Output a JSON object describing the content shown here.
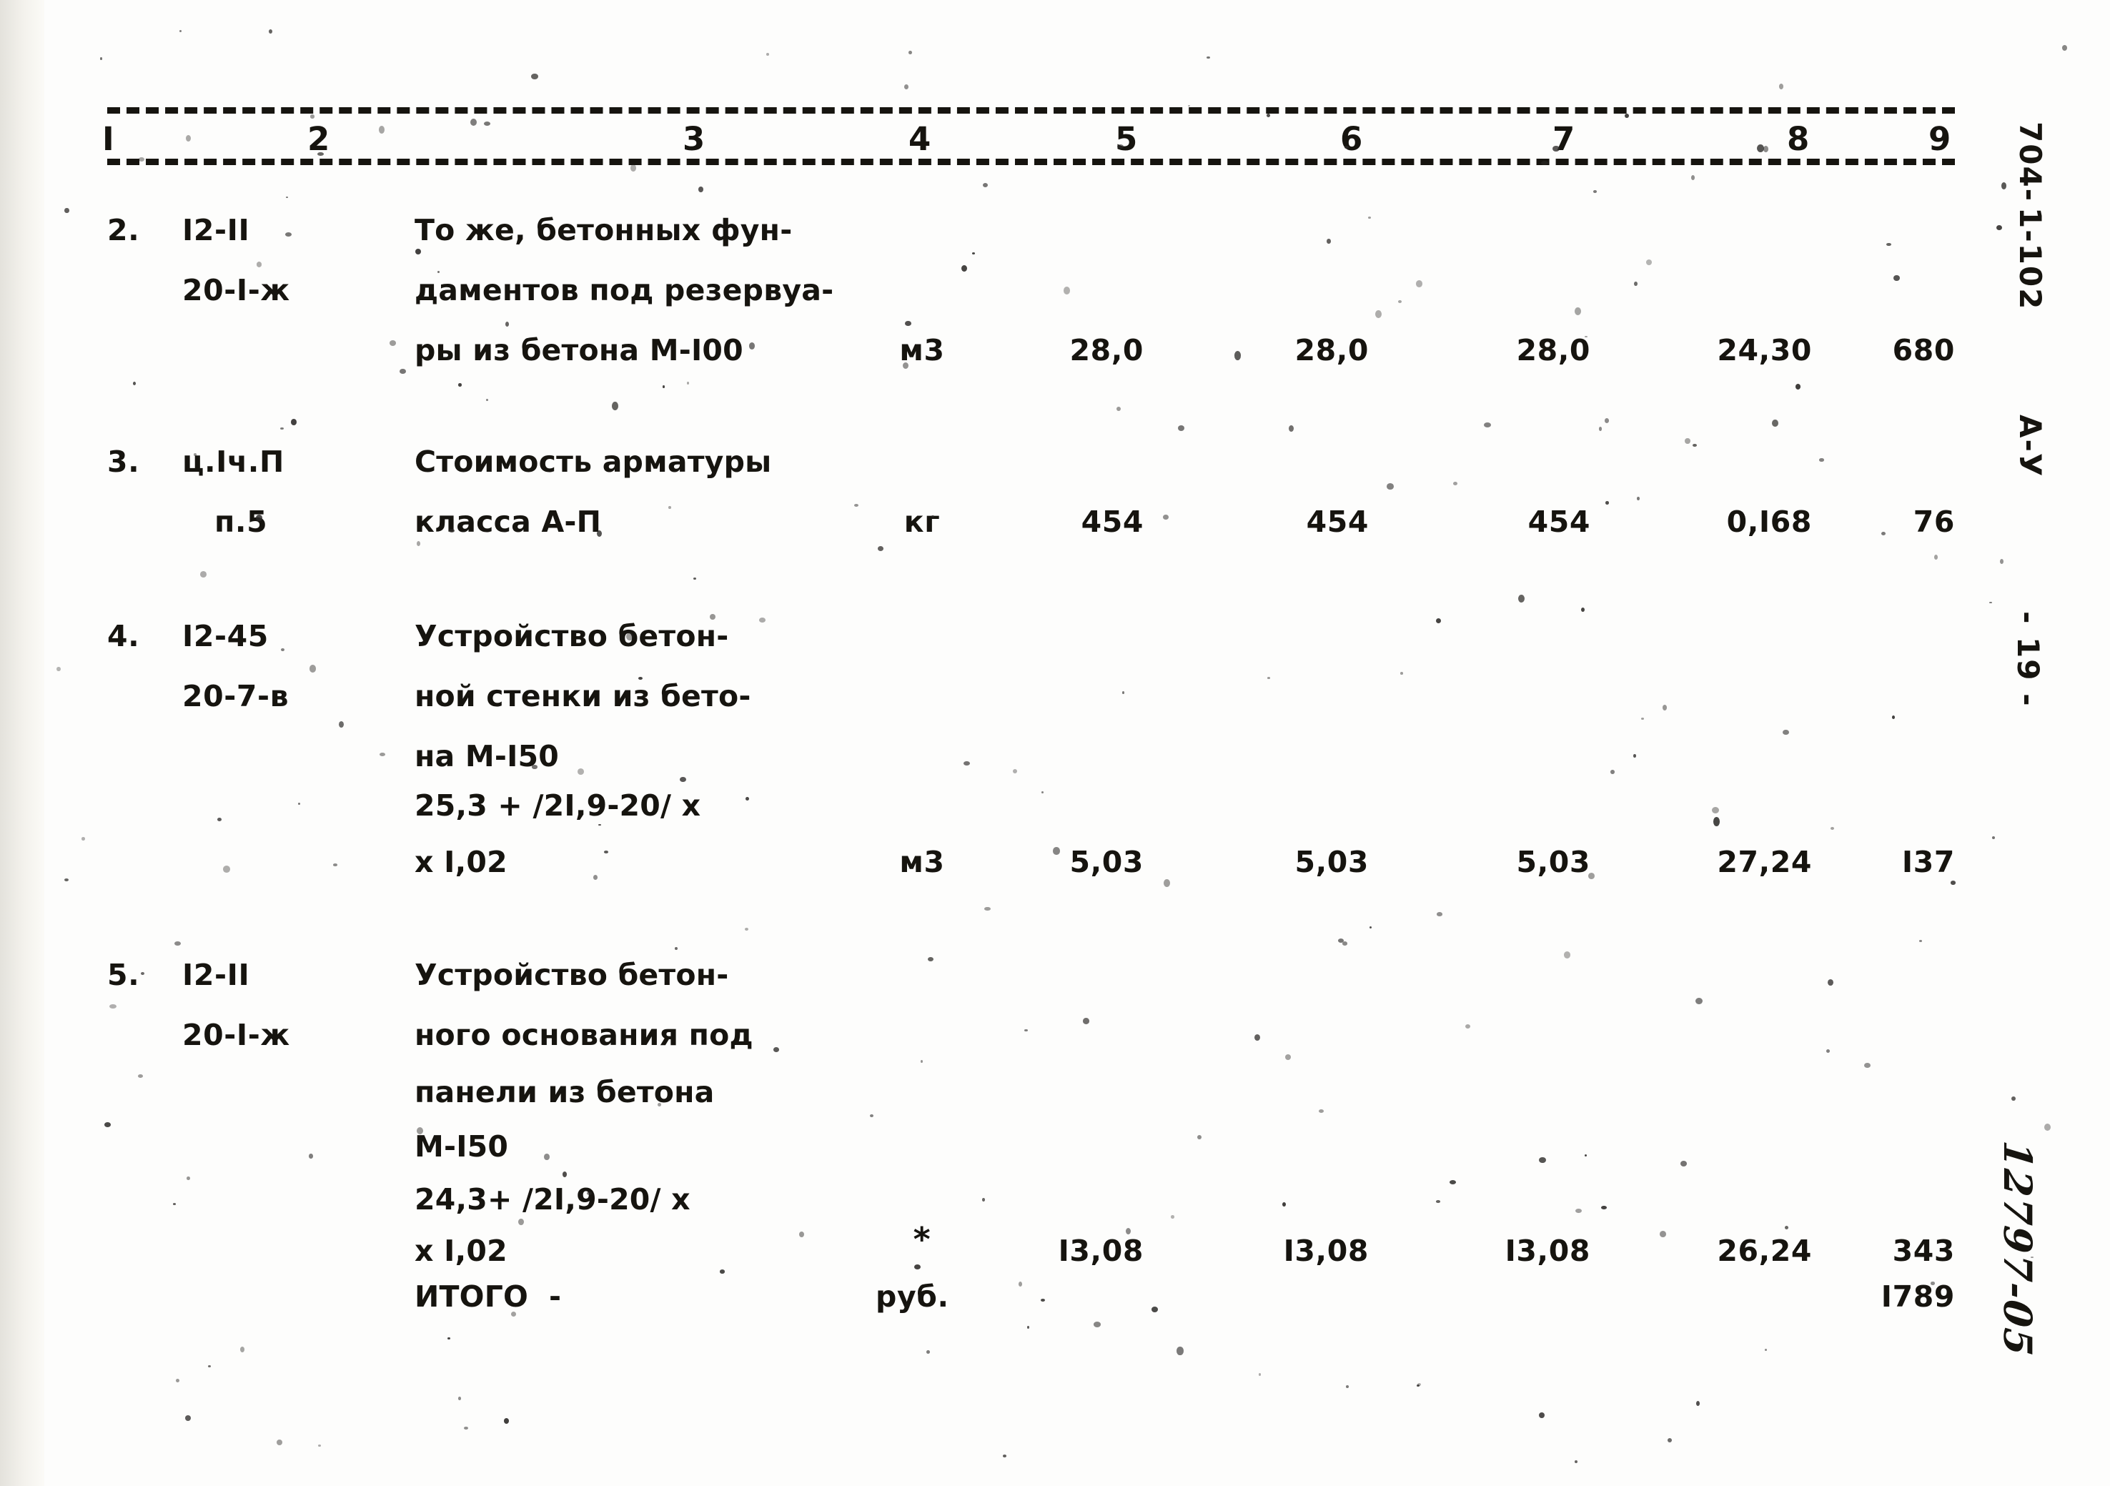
{
  "document": {
    "margin_code_top": "704-",
    "margin_code_mid": "1-102",
    "margin_series": "А-У",
    "page_number": "- 19 -",
    "handwritten_stamp": "12797-05"
  },
  "table": {
    "column_numbers": [
      "I",
      "2",
      "3",
      "4",
      "5",
      "6",
      "7",
      "8",
      "9"
    ],
    "rows": [
      {
        "no": "2.",
        "code_line1": "I2-II",
        "code_line2": "20-I-ж",
        "description": [
          "То же, бетонных фун-",
          "даментов под резервуа-",
          "ры из бетона М-I00"
        ],
        "unit": "м3",
        "c5": "28,0",
        "c6": "28,0",
        "c7": "28,0",
        "c8": "24,30",
        "c9": "680"
      },
      {
        "no": "3.",
        "code_line1": "ц.Iч.П",
        "code_line2": "п.5",
        "description": [
          "Стоимость арматуры",
          "класса А-П"
        ],
        "unit": "кг",
        "c5": "454",
        "c6": "454",
        "c7": "454",
        "c8": "0,I68",
        "c9": "76"
      },
      {
        "no": "4.",
        "code_line1": "I2-45",
        "code_line2": "20-7-в",
        "description": [
          "Устройство бетон-",
          "ной стенки из бето-",
          "на М-I50",
          "25,3 + /2I,9-20/ х",
          "х I,02"
        ],
        "unit": "м3",
        "c5": "5,03",
        "c6": "5,03",
        "c7": "5,03",
        "c8": "27,24",
        "c9": "I37"
      },
      {
        "no": "5.",
        "code_line1": "I2-II",
        "code_line2": "20-I-ж",
        "description": [
          "Устройство бетон-",
          "ного основания под",
          "панели из бетона",
          "М-I50",
          "24,3+ /2I,9-20/ х",
          "х I,02"
        ],
        "unit": "*",
        "c5": "I3,08",
        "c6": "I3,08",
        "c7": "I3,08",
        "c8": "26,24",
        "c9": "343"
      }
    ],
    "total": {
      "label": "ИТОГО  -",
      "unit": "руб.",
      "value": "I789"
    }
  }
}
